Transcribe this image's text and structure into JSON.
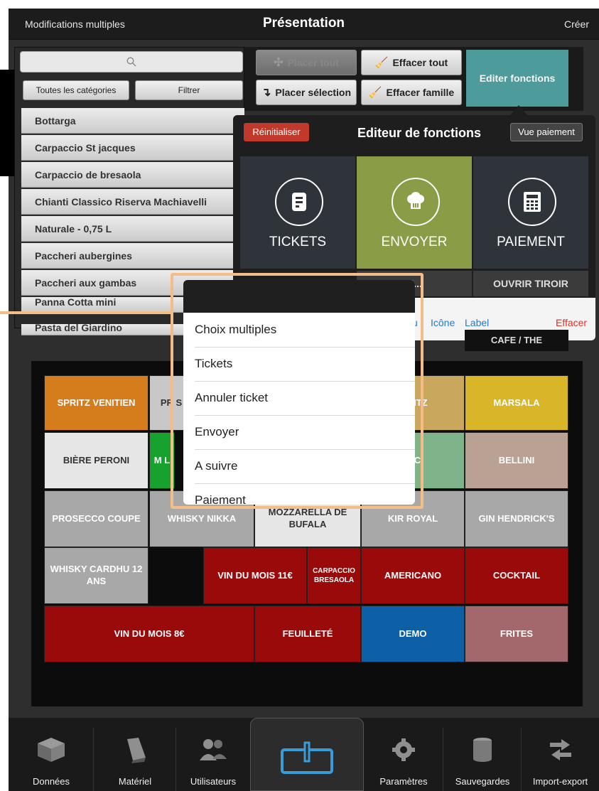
{
  "topbar": {
    "left": "Modifications multiples",
    "title": "Présentation",
    "right": "Créer"
  },
  "left_panel": {
    "search_icon": "search-icon",
    "categories_label": "Toutes les catégories",
    "filter_label": "Filtrer",
    "items": [
      "Bottarga",
      "Carpaccio St jacques",
      "Carpaccio de bresaola",
      "Chianti Classico Riserva Machiavelli",
      "Naturale - 0,75 L",
      "Paccheri aubergines",
      "Paccheri aux gambas",
      "Panna Cotta mini",
      "Pasta del Giardino"
    ]
  },
  "toolbar": {
    "place_all": "Placer tout",
    "clear_all": "Effacer tout",
    "place_selection": "Placer sélection",
    "clear_family": "Effacer famille",
    "edit_functions": "Editer fonctions"
  },
  "editor": {
    "reset": "Réinitialiser",
    "title": "Editeur de fonctions",
    "payment_view": "Vue paiement",
    "tiles": [
      {
        "label": "TICKETS",
        "icon": "ticket-icon",
        "color": "#2f343a"
      },
      {
        "label": "ENVOYER",
        "icon": "chef-hat-icon",
        "color": "#8a9c45"
      },
      {
        "label": "PAIEMENT",
        "icon": "calculator-icon",
        "color": "#2f343a"
      }
    ],
    "sub_tiles": [
      "U...",
      "OUVRIR TIROIR"
    ],
    "links": [
      "u",
      "Icône",
      "Label"
    ],
    "delete": "Effacer",
    "cafe": "CAFE / THE"
  },
  "grid": [
    {
      "label": "SPRITZ VENITIEN",
      "color": "#d57d1c"
    },
    {
      "label": "PR S",
      "color": "#c8c8c8"
    },
    {
      "label": "S RITZ",
      "color": "#c9a85d"
    },
    {
      "label": "MARSALA",
      "color": "#d9b528"
    },
    {
      "label": "BIÈRE PERONI",
      "color": "#e6e6e6"
    },
    {
      "label": "M L",
      "color": "#17a12e"
    },
    {
      "label": "NIC",
      "color": "#7fb38a"
    },
    {
      "label": "BELLINI",
      "color": "#b9a294"
    },
    {
      "label": "PROSECCO COUPE",
      "color": "#a8a8a8"
    },
    {
      "label": "WHISKY NIKKA",
      "color": "#a8a8a8"
    },
    {
      "label": "MOZZARELLA DE BUFALA",
      "color": "#e6e6e6"
    },
    {
      "label": "KIR ROYAL",
      "color": "#a8a8a8"
    },
    {
      "label": "GIN HENDRICK'S",
      "color": "#a8a8a8"
    },
    {
      "label": "WHISKY CARDHU 12 ANS",
      "color": "#a8a8a8"
    },
    {
      "label": "VIN DU MOIS 11€",
      "color": "#9b0a0a"
    },
    {
      "label": "CARPACCIO BRESAOLA",
      "color": "#9b0a0a"
    },
    {
      "label": "AMERICANO",
      "color": "#9b0a0a"
    },
    {
      "label": "COCKTAIL",
      "color": "#9b0a0a"
    },
    {
      "label": "VIN DU MOIS 8€",
      "color": "#9b0a0a"
    },
    {
      "label": "FEUILLETÉ",
      "color": "#9b0a0a"
    },
    {
      "label": "DEMO",
      "color": "#0d5fa6"
    },
    {
      "label": "FRITES",
      "color": "#a2686c"
    }
  ],
  "menu": {
    "items": [
      "Choix multiples",
      "Tickets",
      "Annuler ticket",
      "Envoyer",
      "A suivre",
      "Paiement"
    ]
  },
  "bottom_tabs": [
    {
      "label": "Données",
      "icon": "box-icon"
    },
    {
      "label": "Matériel",
      "icon": "device-icon"
    },
    {
      "label": "Utilisateurs",
      "icon": "users-icon"
    },
    {
      "label": "",
      "icon": "power-icon"
    },
    {
      "label": "Paramètres",
      "icon": "gear-icon"
    },
    {
      "label": "Sauvegardes",
      "icon": "database-icon"
    },
    {
      "label": "Import-export",
      "icon": "arrows-icon"
    }
  ]
}
